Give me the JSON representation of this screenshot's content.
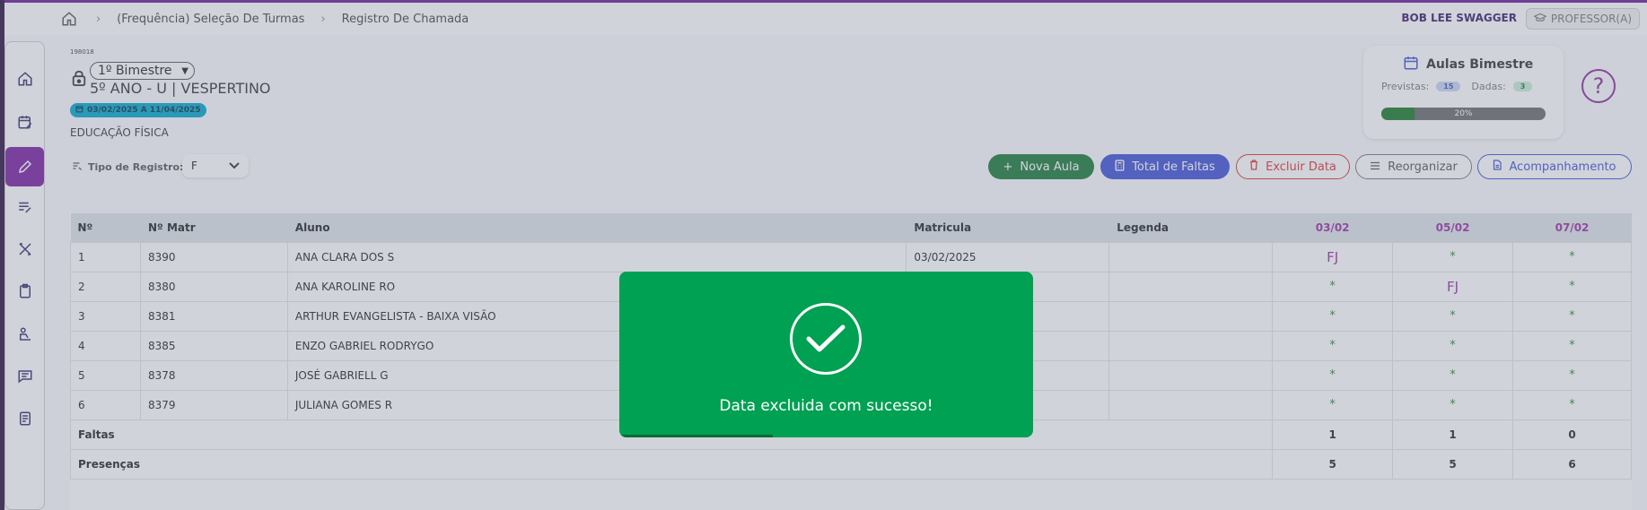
{
  "header": {
    "breadcrumbs": [
      "(Frequência) Seleção De Turmas",
      "Registro De Chamada"
    ],
    "user_name": "BOB LEE SWAGGER",
    "role": "PROFESSOR(A)"
  },
  "class_info": {
    "code": "198018",
    "bimestre_selected": "1º Bimestre",
    "class_name": "5º ANO - U | VESPERTINO",
    "date_range": "03/02/2025 A 11/04/2025",
    "subject": "EDUCAÇÃO FÍSICA"
  },
  "tipo_registro": {
    "label": "Tipo de Registro:",
    "value": "F"
  },
  "aulas": {
    "title": "Aulas Bimestre",
    "previstas_label": "Previstas:",
    "previstas_value": "15",
    "dadas_label": "Dadas:",
    "dadas_value": "3",
    "progress_label": "20%",
    "progress_fraction": 0.2
  },
  "help": "?",
  "actions": {
    "nova_aula": "Nova Aula",
    "total_faltas": "Total de Faltas",
    "excluir_data": "Excluir Data",
    "reorganizar": "Reorganizar",
    "acompanhamento": "Acompanhamento"
  },
  "table": {
    "headers": {
      "num": "Nº",
      "matr": "Nº Matr",
      "aluno": "Aluno",
      "matricula": "Matricula",
      "legenda": "Legenda",
      "d1": "03/02",
      "d2": "05/02",
      "d3": "07/02"
    },
    "rows": [
      {
        "num": "1",
        "matr": "8390",
        "aluno": "ANA CLARA DOS S",
        "matricula": "03/02/2025",
        "legenda": "",
        "d1": "FJ",
        "d2": "*",
        "d3": "*"
      },
      {
        "num": "2",
        "matr": "8380",
        "aluno": "ANA KAROLINE RO",
        "matricula": "",
        "legenda": "",
        "d1": "*",
        "d2": "FJ",
        "d3": "*"
      },
      {
        "num": "3",
        "matr": "8381",
        "aluno": "ARTHUR EVANGELISTA - BAIXA VISÃO",
        "matricula": "",
        "legenda": "",
        "d1": "*",
        "d2": "*",
        "d3": "*"
      },
      {
        "num": "4",
        "matr": "8385",
        "aluno": "ENZO GABRIEL RODRYGO",
        "matricula": "",
        "legenda": "",
        "d1": "*",
        "d2": "*",
        "d3": "*"
      },
      {
        "num": "5",
        "matr": "8378",
        "aluno": "JOSÉ GABRIELL G",
        "matricula": "",
        "legenda": "",
        "d1": "*",
        "d2": "*",
        "d3": "*"
      },
      {
        "num": "6",
        "matr": "8379",
        "aluno": "JULIANA GOMES R",
        "matricula": "",
        "legenda": "",
        "d1": "*",
        "d2": "*",
        "d3": "*"
      }
    ],
    "faltas": {
      "label": "Faltas",
      "d1": "1",
      "d2": "1",
      "d3": "0"
    },
    "presencas": {
      "label": "Presenças",
      "d1": "5",
      "d2": "5",
      "d3": "6"
    }
  },
  "toast": {
    "message": "Data excluida com sucesso!"
  }
}
